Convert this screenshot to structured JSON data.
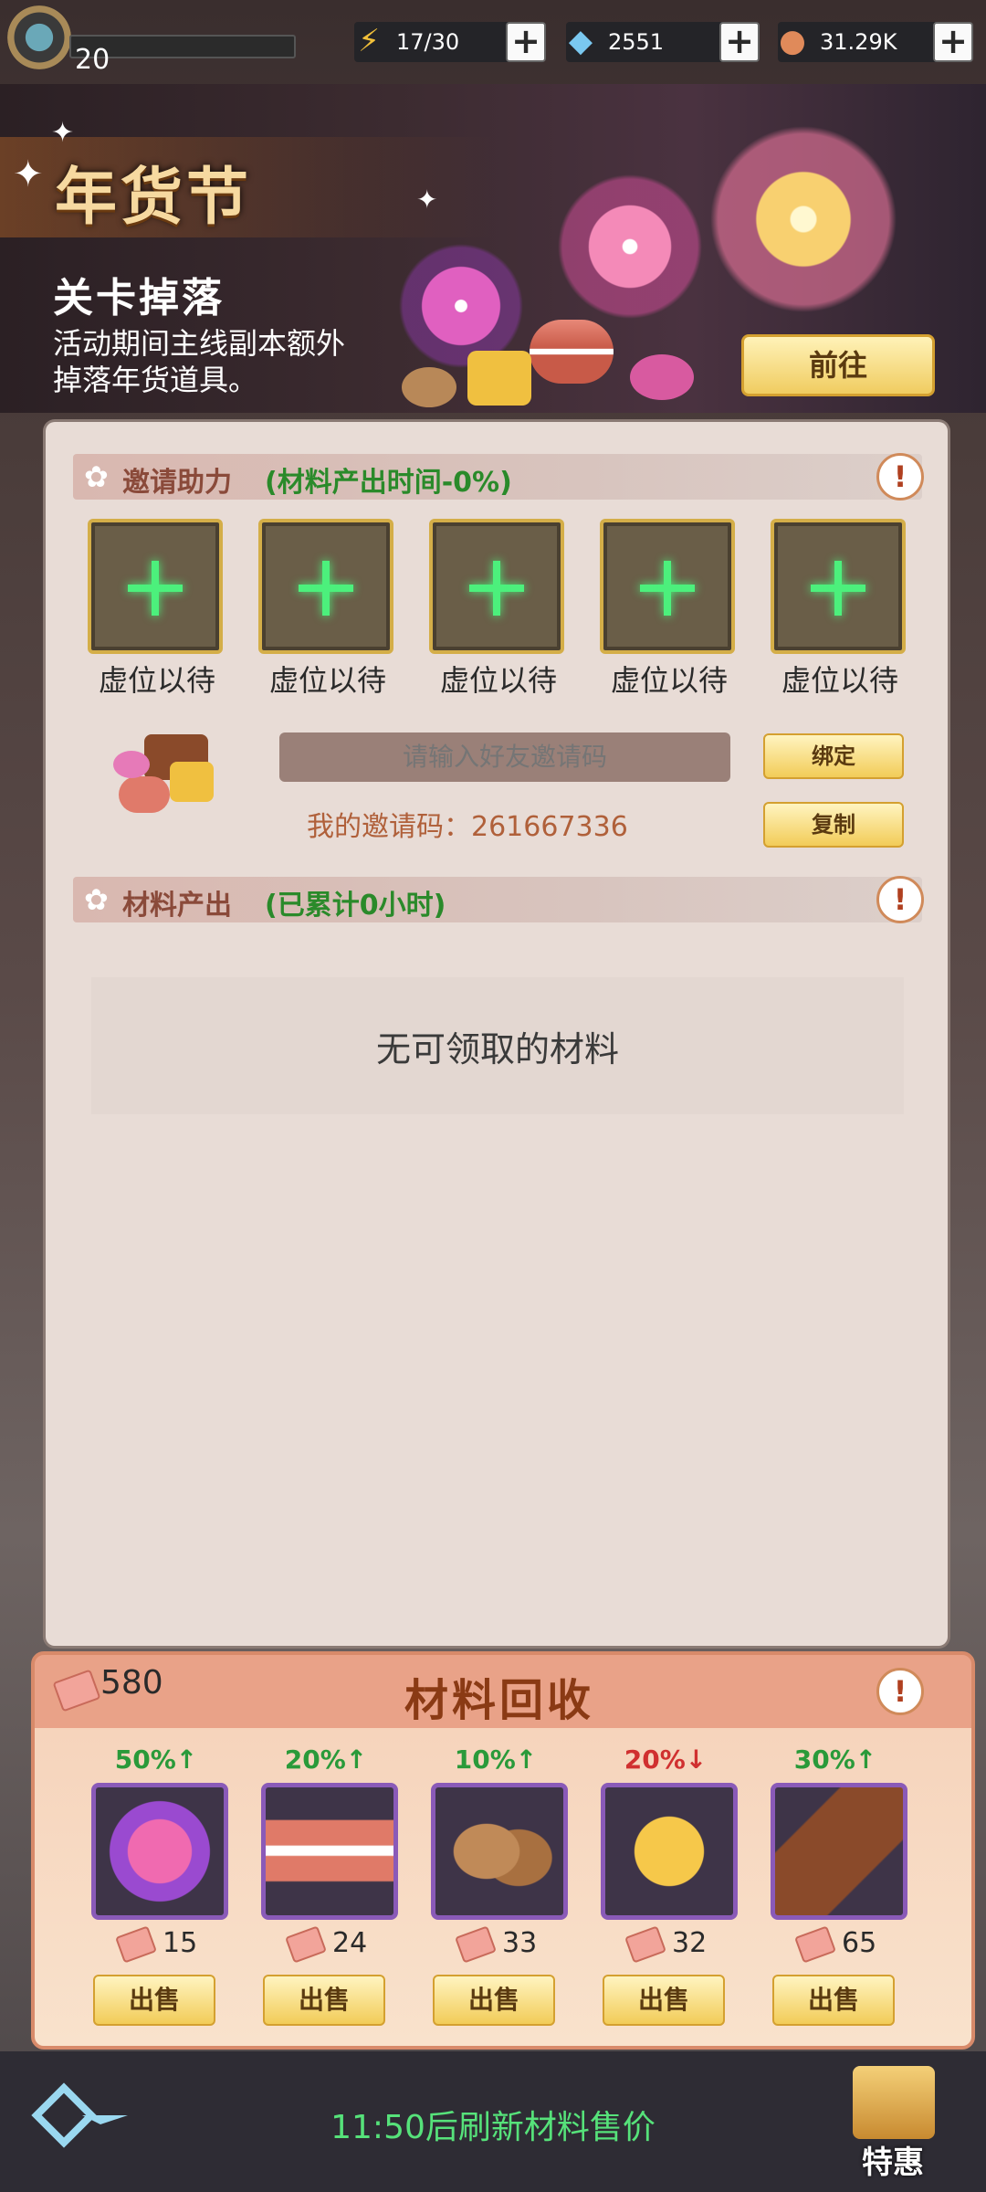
{
  "player": {
    "level": "20"
  },
  "resources": [
    {
      "name": "energy",
      "value": "17/30",
      "icon": "lightning-icon"
    },
    {
      "name": "diamond",
      "value": "2551",
      "icon": "diamond-icon"
    },
    {
      "name": "coin",
      "value": "31.29K",
      "icon": "coin-icon"
    }
  ],
  "banner": {
    "title": "年货节",
    "subtitle": "关卡掉落",
    "description": "活动期间主线副本额外掉落年货道具。",
    "goto_label": "前往"
  },
  "invite": {
    "header": "邀请助力",
    "header_note": "(材料产出时间-0%)",
    "slots": [
      "虚位以待",
      "虚位以待",
      "虚位以待",
      "虚位以待",
      "虚位以待"
    ],
    "input_placeholder": "请输入好友邀请码",
    "bind_label": "绑定",
    "copy_label": "复制",
    "my_code_label": "我的邀请码：",
    "my_code": "261667336"
  },
  "output": {
    "header": "材料产出",
    "header_note": "(已累计0小时)",
    "empty_text": "无可领取的材料"
  },
  "recycle": {
    "title": "材料回收",
    "ticket_amount": "580",
    "items": [
      {
        "name": "candy-icon",
        "pct": "50%",
        "trend": "up",
        "price": "15",
        "sell": "出售"
      },
      {
        "name": "macaron-icon",
        "pct": "20%",
        "trend": "up",
        "price": "24",
        "sell": "出售"
      },
      {
        "name": "almond-icon",
        "pct": "10%",
        "trend": "up",
        "price": "33",
        "sell": "出售"
      },
      {
        "name": "honeycomb-icon",
        "pct": "20%",
        "trend": "down",
        "price": "32",
        "sell": "出售"
      },
      {
        "name": "chocolate-icon",
        "pct": "30%",
        "trend": "up",
        "price": "65",
        "sell": "出售"
      }
    ],
    "colors": {
      "up": "#2a9a3a",
      "down": "#d03030"
    }
  },
  "footer": {
    "refresh_text": "11:50后刷新材料售价",
    "gift_label": "特惠"
  }
}
